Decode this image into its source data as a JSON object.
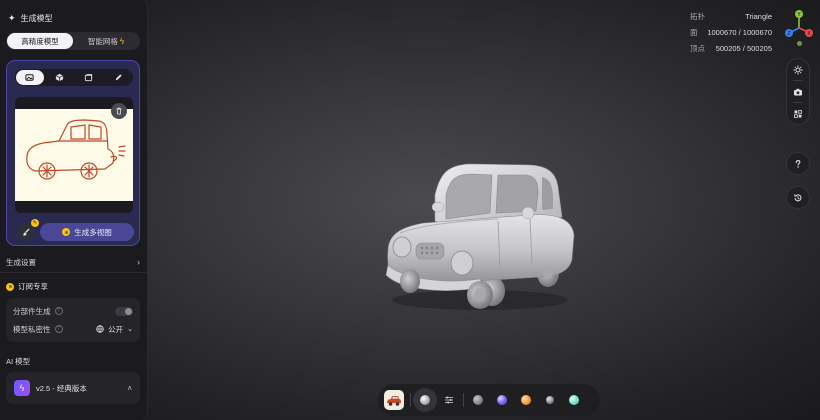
{
  "sidebar": {
    "title": "生成模型",
    "mode_tabs": [
      {
        "label": "高精度模型",
        "active": true
      },
      {
        "label": "智能网格",
        "active": false
      }
    ],
    "input_tools": [
      "image-icon",
      "cube-icon",
      "multi-image-icon",
      "pencil-icon"
    ],
    "generate_views_label": "生成多视图",
    "settings_label": "生成设置",
    "subscription_label": "订阅专享",
    "options": {
      "part_generation_label": "分部件生成",
      "privacy_label": "模型私密性",
      "privacy_value": "公开"
    },
    "ai_model_label": "AI 模型",
    "model_name": "v2.5 - 经典版本"
  },
  "stats": {
    "topology_label": "拓扑",
    "topology_value": "Triangle",
    "faces_label": "面",
    "faces_value": "1000670 / 1000670",
    "vertices_label": "顶点",
    "vertices_value": "500205 / 500205"
  },
  "gizmo": {
    "x": "X",
    "y": "Y",
    "z": "Z"
  },
  "right_toolbar": [
    "sun-icon",
    "camera-icon",
    "grid-icon",
    "help-icon",
    "history-icon"
  ],
  "bottom_bar": {
    "materials": [
      {
        "name": "gray-matte",
        "color": "#8c8c92"
      },
      {
        "name": "iridescent",
        "color": "#7a6cff"
      },
      {
        "name": "orange",
        "color": "#f08a2a"
      },
      {
        "name": "gray-dark",
        "color": "#9a9aa2"
      },
      {
        "name": "teal",
        "color": "#6fd9c6"
      }
    ]
  },
  "colors": {
    "accent": "#4a4896",
    "coin": "#f5c21b",
    "card": "#2a2952"
  }
}
